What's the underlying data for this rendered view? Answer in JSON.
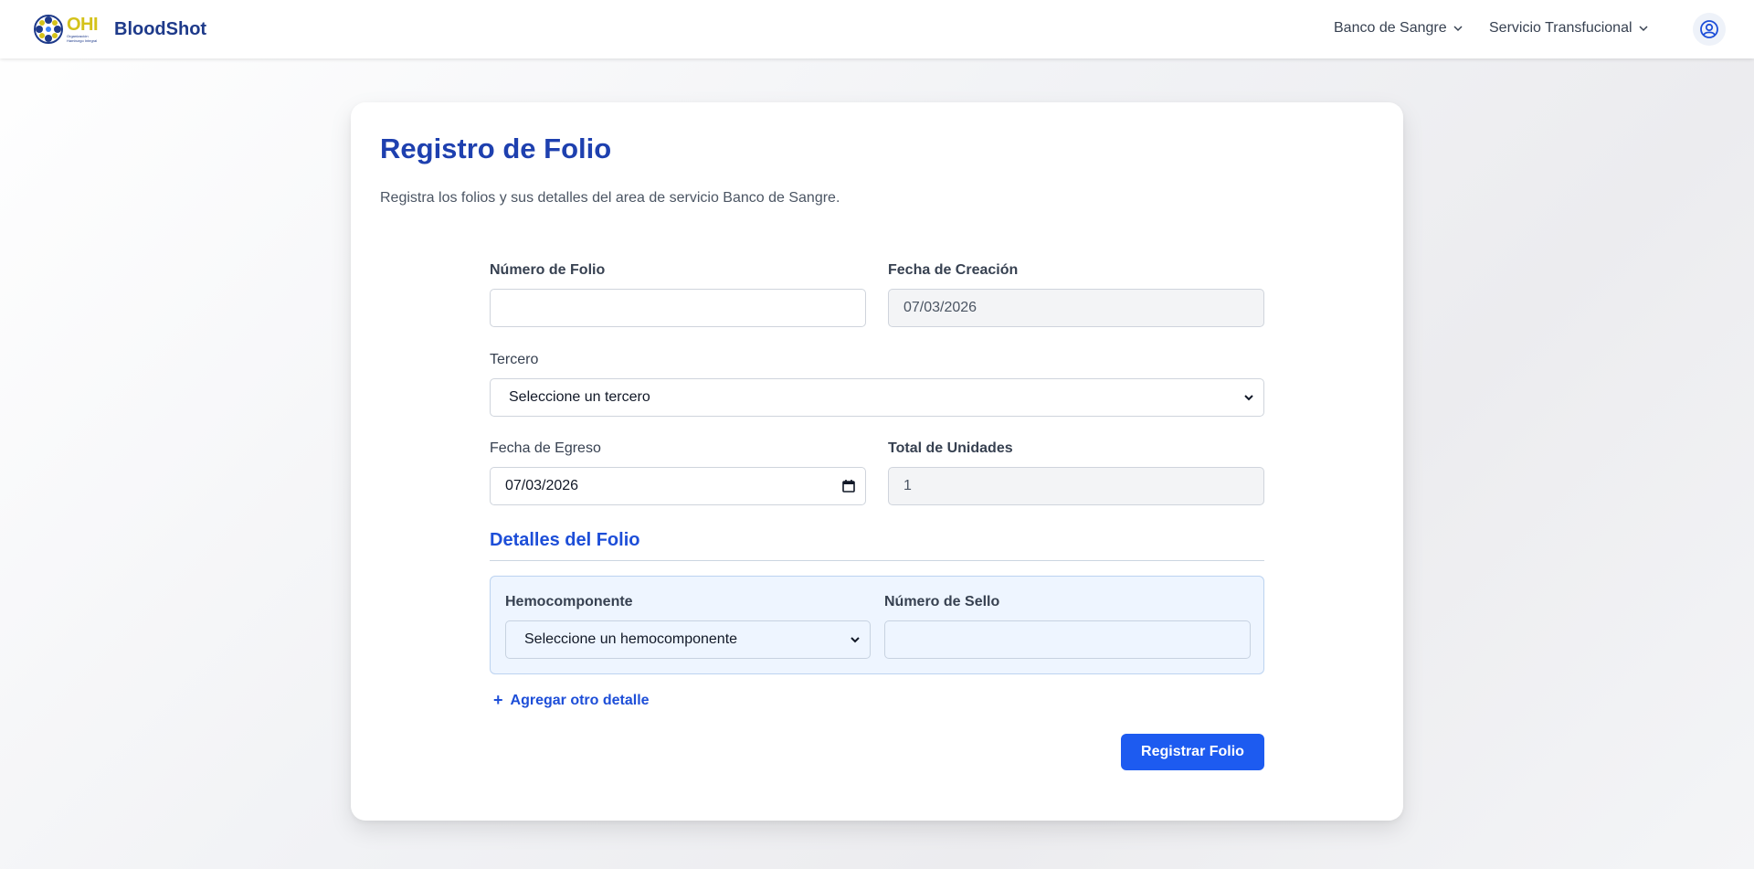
{
  "header": {
    "logo_text": "OHI",
    "logo_subtext": "Organización Hamburgo Integral",
    "app_name": "BloodShot",
    "nav": [
      {
        "label": "Banco de Sangre"
      },
      {
        "label": "Servicio Transfucional"
      }
    ],
    "user_icon": "user-circle-icon"
  },
  "page": {
    "title": "Registro de Folio",
    "description": "Registra los folios y sus detalles del area de servicio Banco de Sangre."
  },
  "form": {
    "numero_folio": {
      "label": "Número de Folio",
      "value": ""
    },
    "fecha_creacion": {
      "label": "Fecha de Creación",
      "value": "07/03/2026"
    },
    "tercero": {
      "label": "Tercero",
      "selected": "Seleccione un tercero"
    },
    "fecha_egreso": {
      "label": "Fecha de Egreso",
      "value": "07/03/2026"
    },
    "total_unidades": {
      "label": "Total de Unidades",
      "value": "1"
    }
  },
  "detalles": {
    "section_title": "Detalles del Folio",
    "hemocomponente": {
      "label": "Hemocomponente",
      "selected": "Seleccione un hemocomponente"
    },
    "numero_sello": {
      "label": "Número de Sello",
      "value": ""
    },
    "add_label": "Agregar otro detalle"
  },
  "actions": {
    "submit_label": "Registrar Folio"
  },
  "colors": {
    "primary": "#1d5bf0",
    "title": "#1e40af",
    "brand_yellow": "#d4c21a",
    "brand_navy": "#1e3a8a"
  }
}
